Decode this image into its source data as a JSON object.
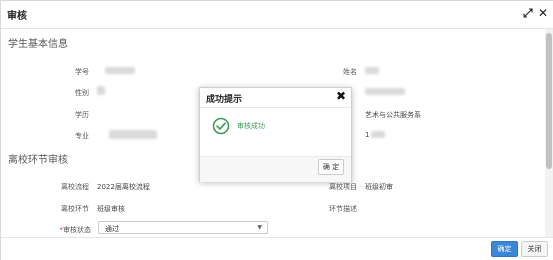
{
  "window": {
    "title": "审核"
  },
  "sections": {
    "basic": "学生基本信息",
    "process": "离校环节审核"
  },
  "basic": {
    "student_id_label": "学号",
    "name_label": "姓名",
    "gender_label": "性别",
    "education_label": "学历",
    "major_label": "专业",
    "college_value": "艺术与公共服务系",
    "grade_value": "1"
  },
  "process": {
    "flow_label": "离校流程",
    "flow_value": "2022届离校流程",
    "item_label": "离校项目",
    "item_value": "班级初审",
    "step_label": "离校环节",
    "step_value": "班级审核",
    "desc_label": "环节描述",
    "status_required_mark": "*",
    "status_label": "审核状态",
    "status_value": "通过"
  },
  "footer": {
    "ok_label": "确定",
    "close_label": "关闭"
  },
  "dialog": {
    "title": "成功提示",
    "message": "审核成功",
    "ok_label": "确 定"
  },
  "colors": {
    "primary": "#3a87d8",
    "success": "#3b9a55"
  },
  "icons": {
    "maximize": "expand-icon",
    "close": "close-icon",
    "success": "check-circle-icon"
  }
}
